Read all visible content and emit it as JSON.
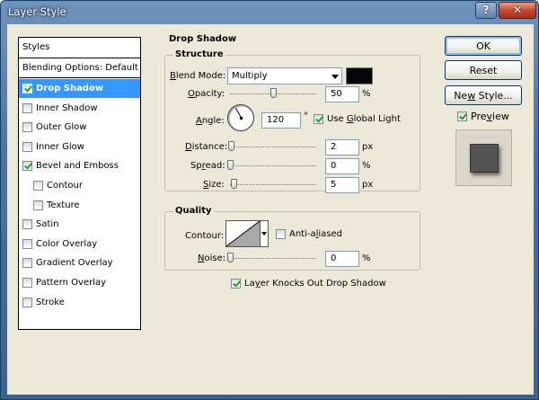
{
  "window": {
    "title": "Layer Style"
  },
  "styles_panel": {
    "header": "Styles",
    "blending_options": "Blending Options: Default",
    "items": [
      {
        "label": "Drop Shadow",
        "checked": true,
        "selected": true,
        "sub": false
      },
      {
        "label": "Inner Shadow",
        "checked": false,
        "selected": false,
        "sub": false
      },
      {
        "label": "Outer Glow",
        "checked": false,
        "selected": false,
        "sub": false
      },
      {
        "label": "Inner Glow",
        "checked": false,
        "selected": false,
        "sub": false
      },
      {
        "label": "Bevel and Emboss",
        "checked": true,
        "selected": false,
        "sub": false
      },
      {
        "label": "Contour",
        "checked": false,
        "selected": false,
        "sub": true
      },
      {
        "label": "Texture",
        "checked": false,
        "selected": false,
        "sub": true
      },
      {
        "label": "Satin",
        "checked": false,
        "selected": false,
        "sub": false
      },
      {
        "label": "Color Overlay",
        "checked": false,
        "selected": false,
        "sub": false
      },
      {
        "label": "Gradient Overlay",
        "checked": false,
        "selected": false,
        "sub": false
      },
      {
        "label": "Pattern Overlay",
        "checked": false,
        "selected": false,
        "sub": false
      },
      {
        "label": "Stroke",
        "checked": false,
        "selected": false,
        "sub": false
      }
    ]
  },
  "drop_shadow": {
    "section_title": "Drop Shadow",
    "structure": {
      "title": "Structure",
      "blend_mode": {
        "label_pre": "",
        "label_mnemonic": "B",
        "label_post": "lend Mode:",
        "value": "Multiply",
        "color": "#050505"
      },
      "opacity": {
        "label_mnemonic": "O",
        "label_post": "pacity:",
        "value": "50",
        "unit": "%",
        "slider_fraction": 0.5
      },
      "angle": {
        "label_mnemonic": "A",
        "label_post": "ngle:",
        "value": "120",
        "unit": "°",
        "degrees": 120
      },
      "use_global_light": {
        "label_pre": "Use ",
        "label_mnemonic": "G",
        "label_post": "lobal Light",
        "checked": true
      },
      "distance": {
        "label_mnemonic": "D",
        "label_post": "istance:",
        "value": "2",
        "unit": "px",
        "slider_fraction": 0.01
      },
      "spread": {
        "label_pre": "Sp",
        "label_mnemonic": "r",
        "label_post": "ead:",
        "value": "0",
        "unit": "%",
        "slider_fraction": 0.0
      },
      "size": {
        "label_mnemonic": "S",
        "label_post": "ize:",
        "value": "5",
        "unit": "px",
        "slider_fraction": 0.04
      }
    },
    "quality": {
      "title": "Quality",
      "contour_label": "Contour:",
      "anti_aliased": {
        "label_pre": "Anti-a",
        "label_mnemonic": "l",
        "label_post": "iased",
        "checked": false
      },
      "noise": {
        "label_mnemonic": "N",
        "label_post": "oise:",
        "value": "0",
        "unit": "%",
        "slider_fraction": 0.0
      }
    },
    "knockout": {
      "label_pre": "La",
      "label_mnemonic": "y",
      "label_post": "er Knocks Out Drop Shadow",
      "checked": true
    }
  },
  "buttons": {
    "ok": "OK",
    "reset": "Reset",
    "new_style_pre": "Ne",
    "new_style_mnemonic": "w",
    "new_style_post": " Style...",
    "preview_pre": "Pre",
    "preview_mnemonic": "v",
    "preview_post": "iew",
    "preview_checked": true
  }
}
